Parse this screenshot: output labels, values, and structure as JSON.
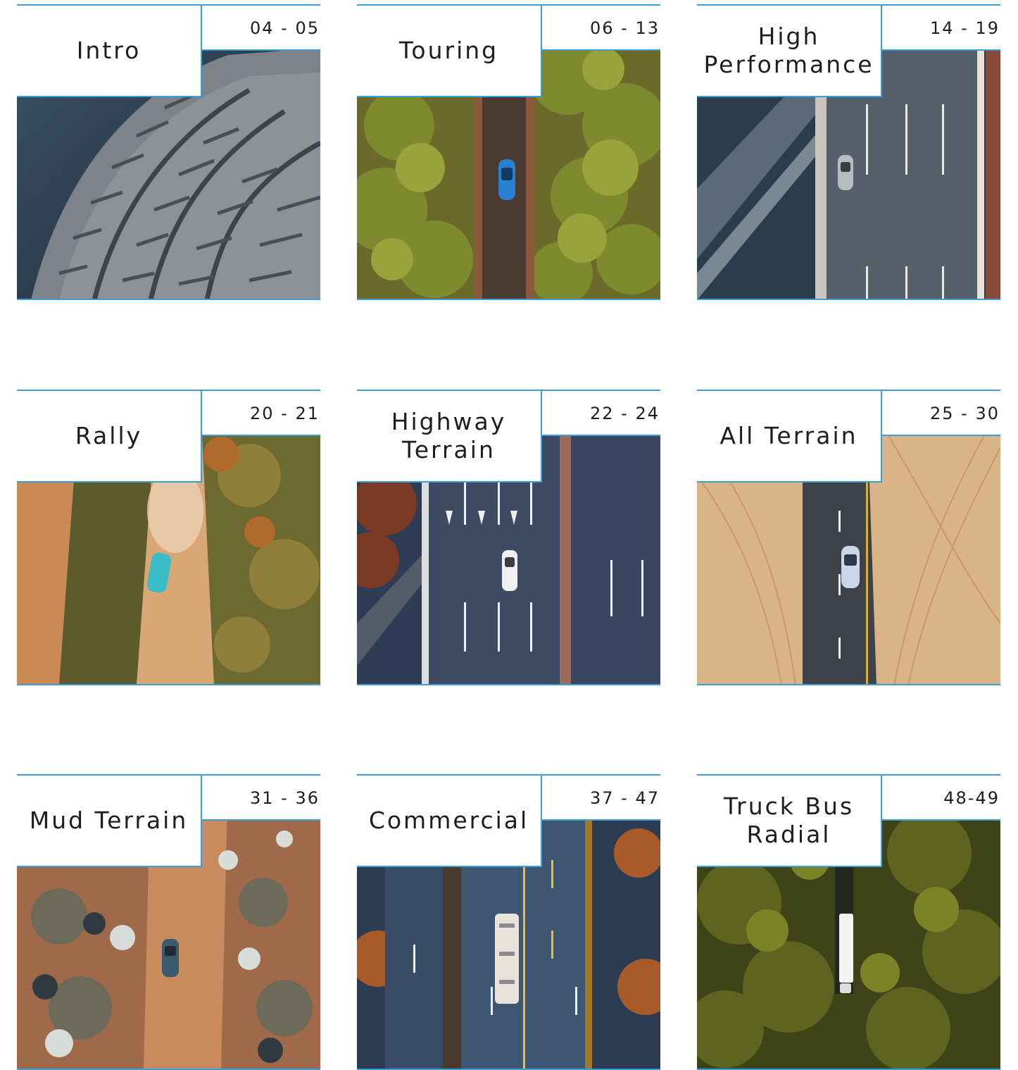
{
  "colors": {
    "accent": "#3aa0d8",
    "text": "#1e1e1e",
    "background": "#ffffff"
  },
  "sections": [
    {
      "title": "Intro",
      "pages": "04 - 05",
      "scene": "tire"
    },
    {
      "title": "Touring",
      "pages": "06 - 13",
      "scene": "forest-road"
    },
    {
      "title": "High\nPerformance",
      "pages": "14 - 19",
      "scene": "highway-gray"
    },
    {
      "title": "Rally",
      "pages": "20 - 21",
      "scene": "rally"
    },
    {
      "title": "Highway\nTerrain",
      "pages": "22 - 24",
      "scene": "highway-blue"
    },
    {
      "title": "All Terrain",
      "pages": "25 - 30",
      "scene": "sand"
    },
    {
      "title": "Mud Terrain",
      "pages": "31 - 36",
      "scene": "mud"
    },
    {
      "title": "Commercial",
      "pages": "37 - 47",
      "scene": "commercial"
    },
    {
      "title": "Truck Bus\nRadial",
      "pages": "48-49",
      "scene": "truck-forest"
    }
  ]
}
